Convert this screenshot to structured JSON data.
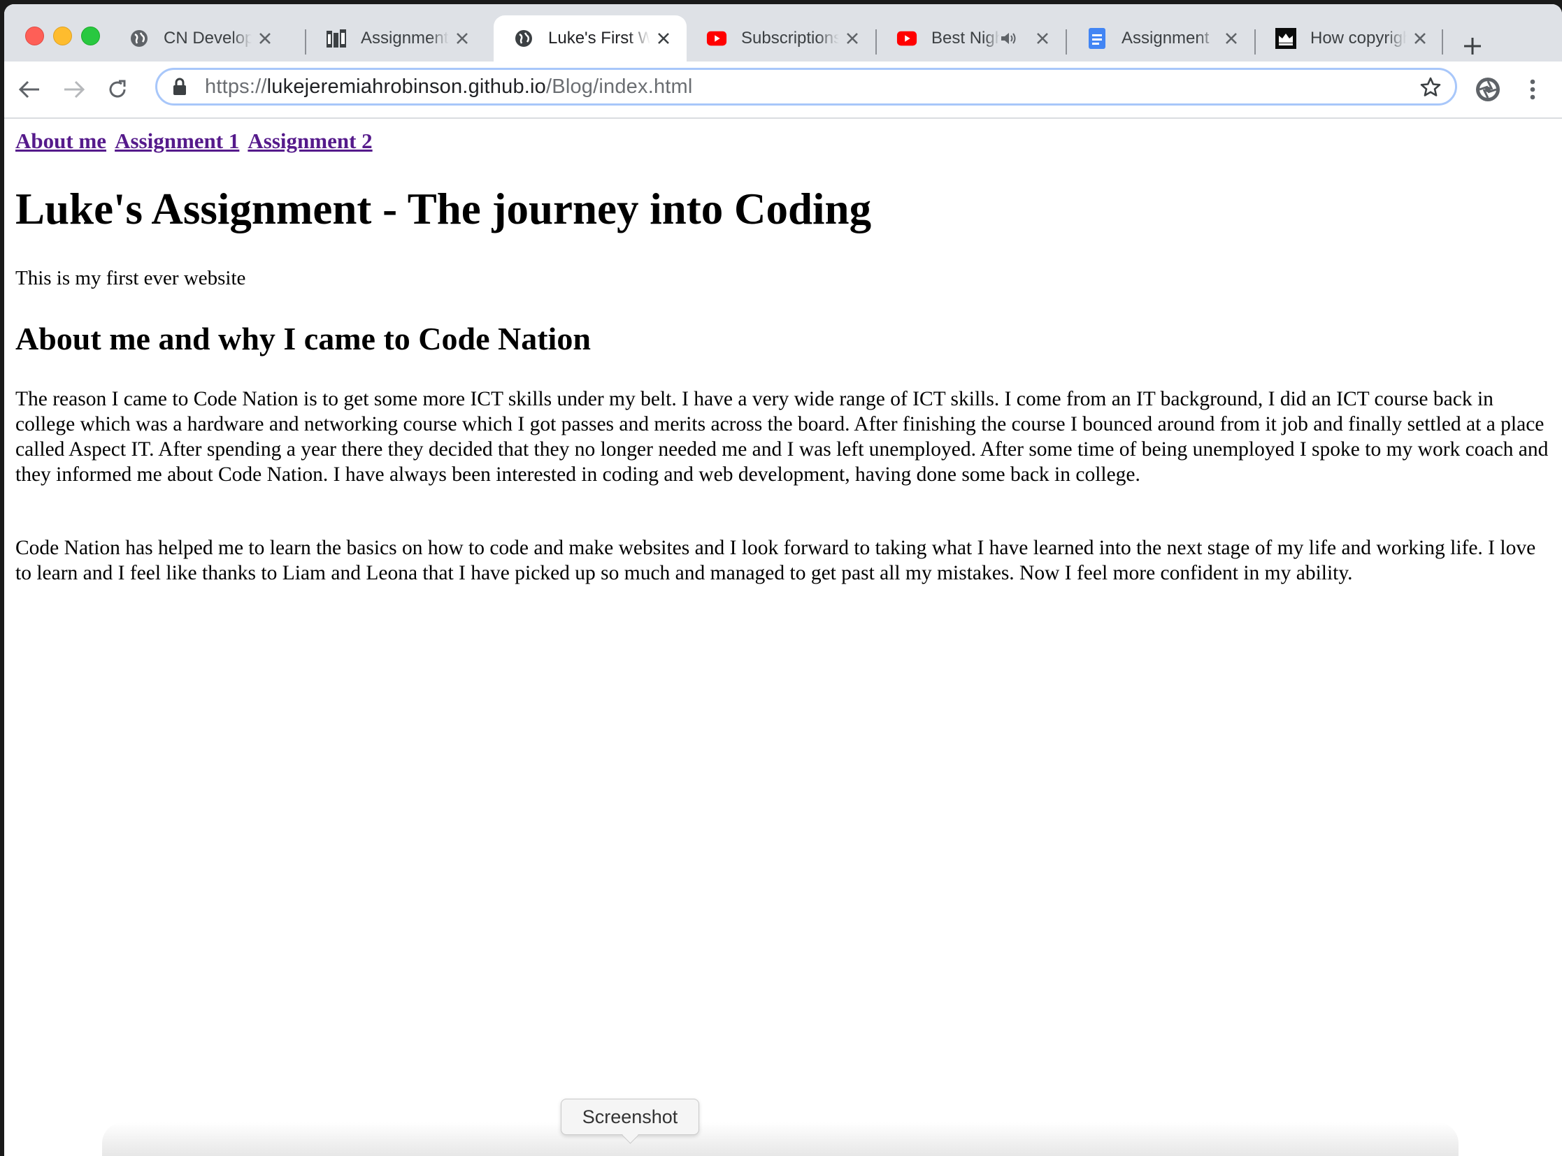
{
  "window_controls": [
    "close",
    "minimize",
    "maximize"
  ],
  "tabs": [
    {
      "title": "CN Developer",
      "icon": "globe-icon",
      "active": false
    },
    {
      "title": "Assignment Week",
      "icon": "books-icon",
      "active": false
    },
    {
      "title": "Luke's First Website",
      "icon": "globe-icon",
      "active": true
    },
    {
      "title": "Subscriptions",
      "icon": "youtube-icon",
      "active": false
    },
    {
      "title": "Best Night",
      "icon": "youtube-icon",
      "active": false,
      "audio": "speaker-icon"
    },
    {
      "title": "Assignment",
      "icon": "google-docs-icon",
      "active": false
    },
    {
      "title": "How copyright",
      "icon": "crown-icon",
      "active": false
    }
  ],
  "toolbar": {
    "url_scheme": "https://",
    "url_host": "lukejeremiahrobinson.github.io",
    "url_path": "/Blog/index.html"
  },
  "page": {
    "nav": [
      "About me",
      "Assignment 1",
      "Assignment 2"
    ],
    "title": "Luke's Assignment - The journey into Coding",
    "intro": "This is my first ever website",
    "subheading": "About me and why I came to Code Nation",
    "paragraphs": [
      "The reason I came to Code Nation is to get some more ICT skills under my belt. I have a very wide range of ICT skills. I come from an IT background, I did an ICT course back in college which was a hardware and networking course which I got passes and merits across the board. After finishing the course I bounced around from it job and finally settled at a place called Aspect IT. After spending a year there they decided that they no longer needed me and I was left unemployed. After some time of being unemployed I spoke to my work coach and they informed me about Code Nation. I have always been interested in coding and web development, having done some back in college.",
      "Code Nation has helped me to learn the basics on how to code and make websites and I look forward to taking what I have learned into the next stage of my life and working life. I love to learn and I feel like thanks to Liam and Leona that I have picked up so much and managed to get past all my mistakes. Now I feel more confident in my ability."
    ]
  },
  "tooltip": "Screenshot",
  "colors": {
    "tabstrip": "#dee1e6",
    "link_visited": "#551a8b",
    "omnibox_focus": "#a8c7fa",
    "youtube_red": "#ff0000",
    "docs_blue": "#4285f4"
  }
}
